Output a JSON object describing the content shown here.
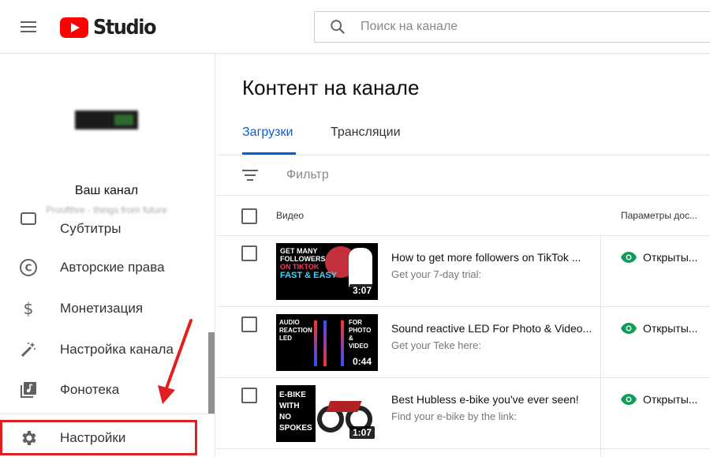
{
  "header": {
    "logo_text": "Studio",
    "search_placeholder": "Поиск на канале"
  },
  "sidebar": {
    "channel_title": "Ваш канал",
    "channel_subtitle": "Proofthre - things from future",
    "items": [
      {
        "label": "Субтитры",
        "icon": "subtitles-icon"
      },
      {
        "label": "Авторские права",
        "icon": "copyright-icon"
      },
      {
        "label": "Монетизация",
        "icon": "dollar-icon"
      },
      {
        "label": "Настройка канала",
        "icon": "magic-wand-icon"
      },
      {
        "label": "Фонотека",
        "icon": "music-library-icon"
      },
      {
        "label": "Настройки",
        "icon": "gear-icon"
      }
    ]
  },
  "main": {
    "title": "Контент на канале",
    "tabs": [
      {
        "label": "Загрузки",
        "active": true
      },
      {
        "label": "Трансляции",
        "active": false
      }
    ],
    "filter_label": "Фильтр",
    "columns": {
      "video": "Видео",
      "visibility": "Параметры дос..."
    },
    "videos": [
      {
        "title": "How to get more followers on TikTok ...",
        "description": "Get your 7-day trial:",
        "duration": "3:07",
        "thumb_text": [
          "GET MANY",
          "FOLLOWERS",
          "ON TIKTOK",
          "FAST & EASY"
        ],
        "visibility": "Открыты..."
      },
      {
        "title": "Sound reactive LED For Photo & Video...",
        "description": "Get your Teke here:",
        "duration": "0:44",
        "thumb_text": [
          "AUDIO",
          "REACTION",
          "LED",
          "FOR",
          "PHOTO",
          "&",
          "VIDEO"
        ],
        "visibility": "Открыты..."
      },
      {
        "title": "Best Hubless e-bike you've ever seen!",
        "description": "Find your e-bike by the link:",
        "duration": "1:07",
        "thumb_text": [
          "E-BIKE",
          "WITH",
          "NO",
          "SPOKES"
        ],
        "visibility": "Открыты..."
      }
    ]
  },
  "colors": {
    "accent": "#065fd4",
    "brand": "#ff0000",
    "public": "#0f9d58",
    "highlight": "#e02020"
  }
}
